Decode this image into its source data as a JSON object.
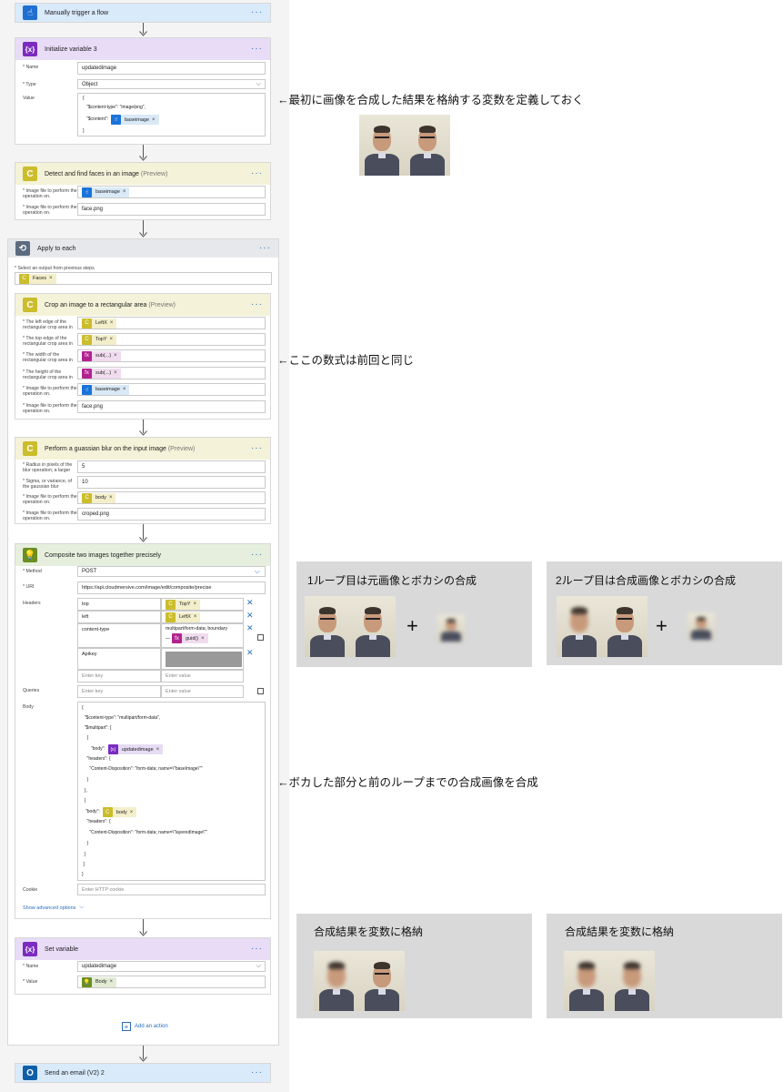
{
  "flow": {
    "trigger": {
      "title": "Manually trigger a flow",
      "dots": "···"
    },
    "init_var": {
      "title": "Initialize variable 3",
      "dots": "···",
      "name_label": "* Name",
      "name_value": "updatedimage",
      "type_label": "* Type",
      "type_value": "Object",
      "value_label": "Value",
      "value_line1": "{",
      "value_line2": "\"$content-type\": \"image/png\",",
      "value_line3": "\"$content\":",
      "value_token": "baseimage",
      "value_line4": "}"
    },
    "detect": {
      "title": "Detect and find faces in an image",
      "preview": "(Preview)",
      "dots": "···",
      "f1_label": "* Image file to perform the operation on.",
      "f1_token": "baseimage",
      "f2_label": "* Image file to perform the operation on.",
      "f2_value": "face.png"
    },
    "apply_each": {
      "title": "Apply to each",
      "dots": "···",
      "select_label": "* Select an output from previous steps",
      "select_token": "Faces"
    },
    "crop": {
      "title": "Crop an image to a rectangular area",
      "preview": "(Preview)",
      "dots": "···",
      "f1_label": "* The left edge of the rectangular crop area in",
      "f1_token": "LeftX",
      "f2_label": "* The top edge of the rectangular crop area in",
      "f2_token": "TopY",
      "f3_label": "* The width of the rectangular crop area in",
      "f3_token": "sub(...)",
      "f4_label": "* The height of the rectangular crop area in",
      "f4_token": "sub(...)",
      "f5_label": "* Image file to perform the operation on.",
      "f5_token": "baseimage",
      "f6_label": "* Image file to perform the operation on.",
      "f6_value": "face.png"
    },
    "blur": {
      "title": "Perform a guassian blur on the input image",
      "preview": "(Preview)",
      "dots": "···",
      "f1_label": "* Radius in pixels of the blur operation; a larger",
      "f1_value": "5",
      "f2_label": "* Sigma, or variance, of the gaussian blur",
      "f2_value": "10",
      "f3_label": "* Image file to perform the operation on.",
      "f3_token": "body",
      "f4_label": "* Image file to perform the operation on.",
      "f4_value": "croped.png"
    },
    "composite": {
      "title": "Composite two images together precisely",
      "dots": "···",
      "method_label": "* Method",
      "method_value": "POST",
      "uri_label": "* URI",
      "uri_value": "https://api.cloudmersive.com/image/edit/composite/precise",
      "headers_label": "Headers",
      "h1_key": "top",
      "h1_token": "TopY",
      "h2_key": "left",
      "h2_token": "LeftX",
      "h3_key": "content-type",
      "h3_value": "multipart/form-data; boundary",
      "h3_dash": "—",
      "h3_token": "guid()",
      "h4_key": "Apikey",
      "enter_key": "Enter key",
      "enter_value": "Enter value",
      "queries_label": "Queries",
      "body_label": "Body",
      "body_lines": [
        "{",
        "  \"$content-type\": \"multipart/form-data\",",
        "  \"$multipart\": [",
        "    {"
      ],
      "body_l5": "\"body\":",
      "body_tok1": "updatedimage",
      "body_lines2": [
        "    \"headers\": {",
        "      \"Content-Disposition\": \"form-data; name=\\\"baseImage\\\"\"",
        "    }",
        "  },",
        "  {"
      ],
      "body_l11": "\"body\":",
      "body_tok2": "body",
      "body_lines3": [
        "    \"headers\": {",
        "      \"Content-Disposition\": \"form-data; name=\\\"layeredImage\\\"\"",
        "    }",
        "  }",
        " ]",
        "}"
      ],
      "cookie_label": "Cookie",
      "cookie_placeholder": "Enter HTTP cookie",
      "advanced": "Show advanced options"
    },
    "set_var": {
      "title": "Set variable",
      "dots": "···",
      "name_label": "* Name",
      "name_value": "updatedimage",
      "value_label": "* Value",
      "value_token": "Body"
    },
    "add_action": "Add an action",
    "email": {
      "title": "Send an email (V2) 2",
      "dots": "···"
    }
  },
  "annotations": {
    "a1": "←最初に画像を合成した結果を格納する変数を定義しておく",
    "a2": "←ここの数式は前回と同じ",
    "a3": "←ボカした部分と前のループまでの合成画像を合成"
  },
  "boxes": {
    "loop1": "1ループ目は元画像とボカシの合成",
    "loop2": "2ループ目は合成画像とボカシの合成",
    "result1": "合成結果を変数に格納",
    "result2": "合成結果を変数に格納",
    "plus": "+"
  },
  "icons": {
    "trigger": "hand-touch-icon",
    "variable": "variable-icon",
    "cloudmersive": "cloudmersive-icon",
    "loop": "loop-icon",
    "bulb": "lightbulb-icon",
    "outlook": "outlook-icon",
    "add": "add-action-icon"
  },
  "colors": {
    "trigger_header": "#d9eafb",
    "variable_header": "#e8dcf7",
    "cloudmersive_header": "#f4f2d8",
    "loop_header": "#e6e8ec",
    "composite_header": "#e6efdd",
    "email_header": "#d9eafb",
    "link": "#2a6ebb"
  }
}
